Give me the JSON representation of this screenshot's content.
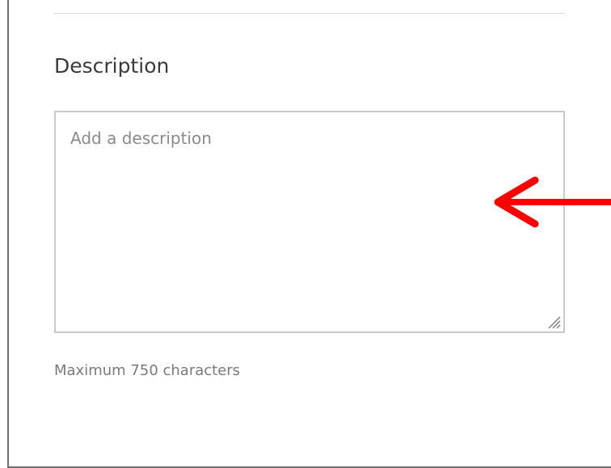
{
  "description_section": {
    "title": "Description",
    "textarea_placeholder": "Add a description",
    "textarea_value": "",
    "helper_text": "Maximum 750 characters"
  },
  "annotation": {
    "arrow_color": "#ff0000",
    "arrow_direction": "left"
  },
  "icons": {
    "resize_handle": "resize-grip-icon"
  }
}
